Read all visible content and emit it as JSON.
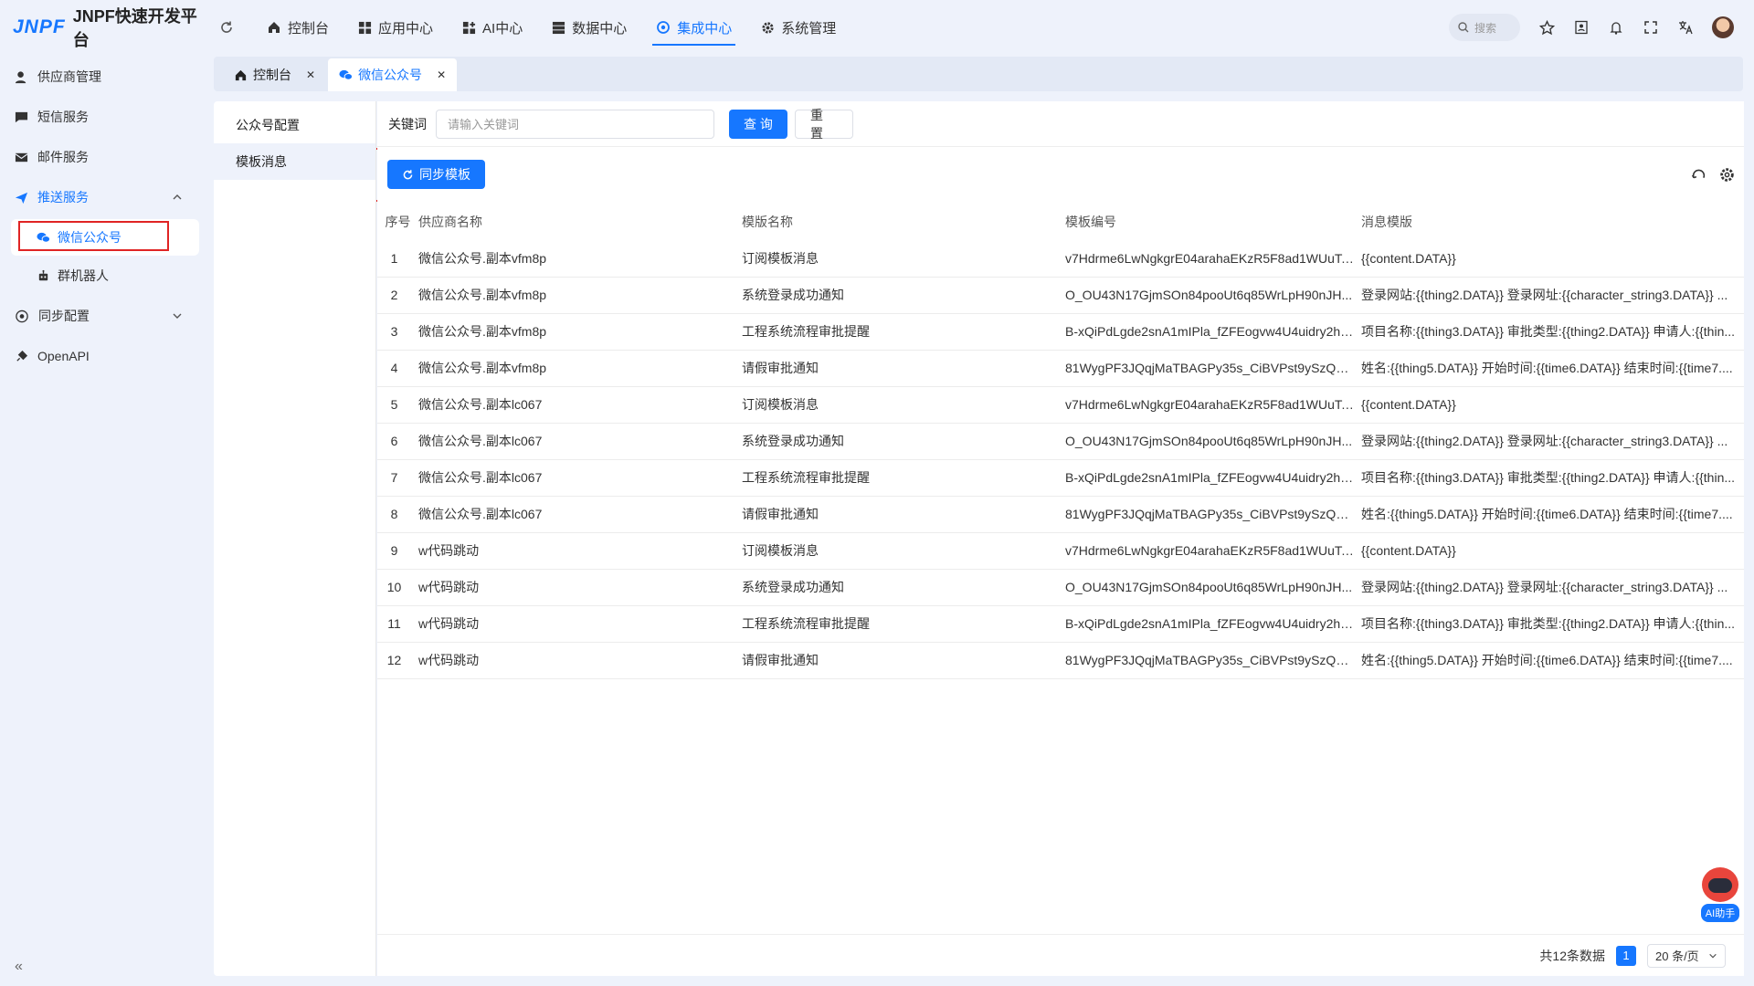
{
  "app": {
    "logo_mark": "JNPF",
    "title": "JNPF快速开发平台"
  },
  "nav": [
    {
      "label": "控制台",
      "icon": "home-icon"
    },
    {
      "label": "应用中心",
      "icon": "grid-icon"
    },
    {
      "label": "AI中心",
      "icon": "grid-plus-icon"
    },
    {
      "label": "数据中心",
      "icon": "database-icon"
    },
    {
      "label": "集成中心",
      "icon": "integration-icon",
      "active": true
    },
    {
      "label": "系统管理",
      "icon": "gear-icon"
    }
  ],
  "search": {
    "placeholder": "搜索"
  },
  "sidebar": {
    "items": [
      {
        "label": "供应商管理"
      },
      {
        "label": "短信服务"
      },
      {
        "label": "邮件服务"
      },
      {
        "label": "推送服务"
      },
      {
        "label": "微信公众号"
      },
      {
        "label": "群机器人"
      },
      {
        "label": "同步配置"
      },
      {
        "label": "OpenAPI"
      }
    ],
    "collapse": "«"
  },
  "tabs": [
    {
      "label": "控制台"
    },
    {
      "label": "微信公众号"
    }
  ],
  "subpanel": {
    "items": [
      {
        "label": "公众号配置"
      },
      {
        "label": "模板消息"
      }
    ]
  },
  "filter": {
    "label": "关键词",
    "placeholder": "请输入关键词",
    "query": "查 询",
    "reset": "重 置"
  },
  "toolbar": {
    "sync": "同步模板"
  },
  "table": {
    "headers": [
      "序号",
      "供应商名称",
      "模版名称",
      "模板编号",
      "消息模版"
    ],
    "rows": [
      [
        "1",
        "微信公众号.副本vfm8p",
        "订阅模板消息",
        "v7Hdrme6LwNgkgrE04arahaEKzR5F8ad1WUuTa...",
        "{{content.DATA}}"
      ],
      [
        "2",
        "微信公众号.副本vfm8p",
        "系统登录成功通知",
        "O_OU43N17GjmSOn84pooUt6q85WrLpH90nJH...",
        "登录网站:{{thing2.DATA}} 登录网址:{{character_string3.DATA}} ..."
      ],
      [
        "3",
        "微信公众号.副本vfm8p",
        "工程系统流程审批提醒",
        "B-xQiPdLgde2snA1mIPla_fZFEogvw4U4uidry2hH...",
        "项目名称:{{thing3.DATA}} 审批类型:{{thing2.DATA}} 申请人:{{thin..."
      ],
      [
        "4",
        "微信公众号.副本vfm8p",
        "请假审批通知",
        "81WygPF3JQqjMaTBAGPy35s_CiBVPst9ySzQ3sZ...",
        "姓名:{{thing5.DATA}} 开始时间:{{time6.DATA}} 结束时间:{{time7...."
      ],
      [
        "5",
        "微信公众号.副本lc067",
        "订阅模板消息",
        "v7Hdrme6LwNgkgrE04arahaEKzR5F8ad1WUuTa...",
        "{{content.DATA}}"
      ],
      [
        "6",
        "微信公众号.副本lc067",
        "系统登录成功通知",
        "O_OU43N17GjmSOn84pooUt6q85WrLpH90nJH...",
        "登录网站:{{thing2.DATA}} 登录网址:{{character_string3.DATA}} ..."
      ],
      [
        "7",
        "微信公众号.副本lc067",
        "工程系统流程审批提醒",
        "B-xQiPdLgde2snA1mIPla_fZFEogvw4U4uidry2hH...",
        "项目名称:{{thing3.DATA}} 审批类型:{{thing2.DATA}} 申请人:{{thin..."
      ],
      [
        "8",
        "微信公众号.副本lc067",
        "请假审批通知",
        "81WygPF3JQqjMaTBAGPy35s_CiBVPst9ySzQ3sZ...",
        "姓名:{{thing5.DATA}} 开始时间:{{time6.DATA}} 结束时间:{{time7...."
      ],
      [
        "9",
        "w代码跳动",
        "订阅模板消息",
        "v7Hdrme6LwNgkgrE04arahaEKzR5F8ad1WUuTa...",
        "{{content.DATA}}"
      ],
      [
        "10",
        "w代码跳动",
        "系统登录成功通知",
        "O_OU43N17GjmSOn84pooUt6q85WrLpH90nJH...",
        "登录网站:{{thing2.DATA}} 登录网址:{{character_string3.DATA}} ..."
      ],
      [
        "11",
        "w代码跳动",
        "工程系统流程审批提醒",
        "B-xQiPdLgde2snA1mIPla_fZFEogvw4U4uidry2hH...",
        "项目名称:{{thing3.DATA}} 审批类型:{{thing2.DATA}} 申请人:{{thin..."
      ],
      [
        "12",
        "w代码跳动",
        "请假审批通知",
        "81WygPF3JQqjMaTBAGPy35s_CiBVPst9ySzQ3sZ...",
        "姓名:{{thing5.DATA}} 开始时间:{{time6.DATA}} 结束时间:{{time7...."
      ]
    ]
  },
  "pager": {
    "total": "共12条数据",
    "current": "1",
    "page_size": "20 条/页"
  },
  "ai_helper": {
    "label": "AI助手"
  },
  "colors": {
    "accent": "#1677ff",
    "highlight_box": "#e02424"
  }
}
